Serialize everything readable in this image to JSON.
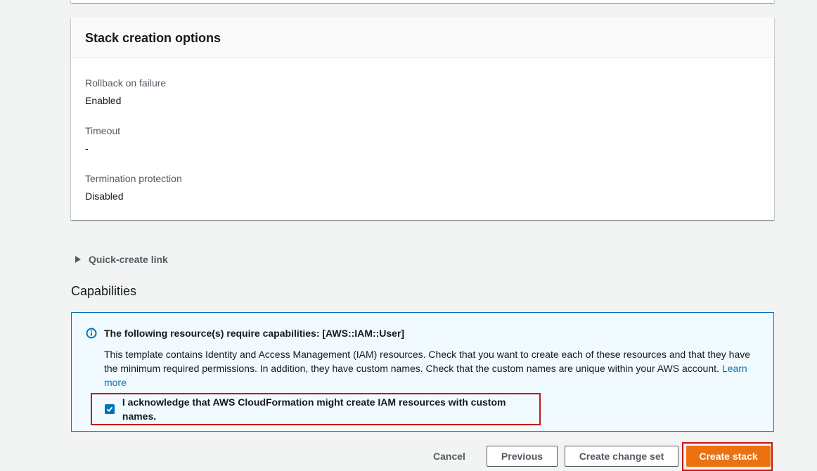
{
  "stack_options": {
    "title": "Stack creation options",
    "fields": [
      {
        "label": "Rollback on failure",
        "value": "Enabled"
      },
      {
        "label": "Timeout",
        "value": "-"
      },
      {
        "label": "Termination protection",
        "value": "Disabled"
      }
    ]
  },
  "quick_create": {
    "label": "Quick-create link"
  },
  "capabilities": {
    "title": "Capabilities",
    "alert_header": "The following resource(s) require capabilities: [AWS::IAM::User]",
    "alert_body": "This template contains Identity and Access Management (IAM) resources. Check that you want to create each of these resources and that they have the minimum required permissions. In addition, they have custom names. Check that the custom names are unique within your AWS account.",
    "learn_more": "Learn more",
    "acknowledge_label": "I acknowledge that AWS CloudFormation might create IAM resources with custom names.",
    "acknowledge_checked": true
  },
  "actions": {
    "cancel": "Cancel",
    "previous": "Previous",
    "create_change_set": "Create change set",
    "create_stack": "Create stack"
  },
  "colors": {
    "primary": "#ec7211",
    "info_blue": "#0073bb",
    "highlight_red": "#c7141a"
  },
  "icons": {
    "info": "info-circle-icon",
    "expand": "caret-right-icon",
    "check": "checkmark-icon"
  }
}
